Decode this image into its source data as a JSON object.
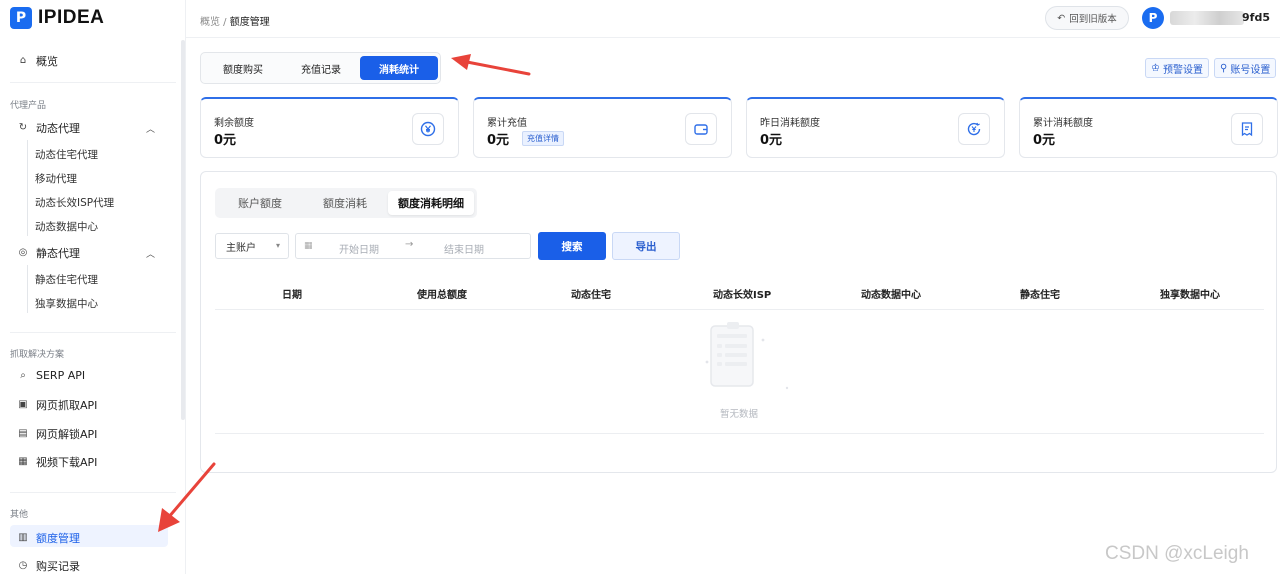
{
  "brand": {
    "mark": "P",
    "name": "IPIDEA"
  },
  "sidebar": {
    "overview": "概览",
    "sections": {
      "proxy_products": "代理产品",
      "scraping": "抓取解决方案",
      "other": "其他"
    },
    "dynamic": {
      "label": "动态代理",
      "children": [
        "动态住宅代理",
        "移动代理",
        "动态长效ISP代理",
        "动态数据中心"
      ]
    },
    "static": {
      "label": "静态代理",
      "children": [
        "静态住宅代理",
        "独享数据中心"
      ]
    },
    "scraping_items": [
      "SERP API",
      "网页抓取API",
      "网页解锁API",
      "视频下载API"
    ],
    "other_items": [
      "额度管理",
      "购买记录"
    ]
  },
  "header": {
    "crumb_parent": "概览 /",
    "crumb_current": "额度管理",
    "back_label": "回到旧版本",
    "avatar_letter": "P",
    "user_suffix": "9fd5"
  },
  "top_tabs": [
    "额度购买",
    "充值记录",
    "消耗统计"
  ],
  "top_right": {
    "alert": "预警设置",
    "account": "账号设置"
  },
  "cards": [
    {
      "label": "剩余额度",
      "value": "0元"
    },
    {
      "label": "累计充值",
      "value": "0元",
      "tag": "充值详情"
    },
    {
      "label": "昨日消耗额度",
      "value": "0元"
    },
    {
      "label": "累计消耗额度",
      "value": "0元"
    }
  ],
  "panel": {
    "seg_tabs": [
      "账户额度",
      "额度消耗",
      "额度消耗明细"
    ],
    "account_select": "主账户",
    "start_placeholder": "开始日期",
    "range_arrow": "→",
    "end_placeholder": "结束日期",
    "search": "搜索",
    "export": "导出",
    "columns": [
      "日期",
      "使用总额度",
      "动态住宅",
      "动态长效ISP",
      "动态数据中心",
      "静态住宅",
      "独享数据中心"
    ],
    "empty": "暂无数据"
  },
  "watermark": "CSDN @xcLeigh",
  "colors": {
    "primary": "#1a5fe8",
    "annotation": "#e8433a"
  }
}
